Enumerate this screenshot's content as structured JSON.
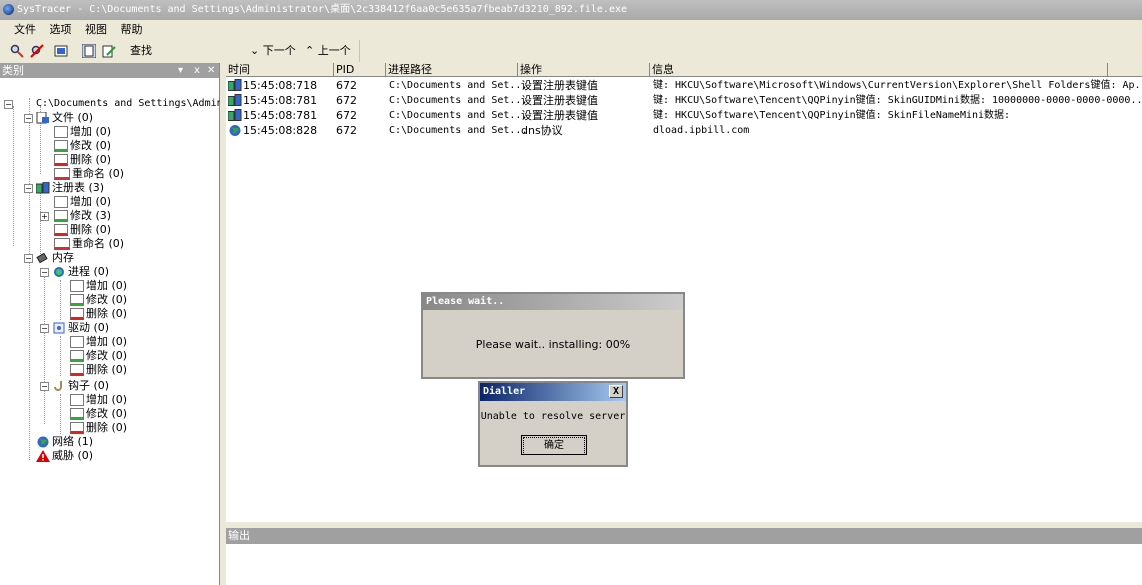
{
  "window": {
    "title": "SysTracer - C:\\Documents and Settings\\Administrator\\桌面\\2c338412f6aa0c5e635a7fbeab7d3210_892.file.exe"
  },
  "menu": [
    "文件",
    "选项",
    "视图",
    "帮助"
  ],
  "toolbar": {
    "search_label": "查找",
    "search_value": "",
    "next_label": "下一个",
    "prev_label": "上一个"
  },
  "left": {
    "title": "类别",
    "controls": [
      "▾",
      "ⅹ",
      "✕"
    ],
    "root": "C:\\Documents and Settings\\Administ",
    "tree": {
      "file": "文件 (0)",
      "file_add": "增加 (0)",
      "file_mod": "修改 (0)",
      "file_del": "删除 (0)",
      "file_ren": "重命名 (0)",
      "reg": "注册表 (3)",
      "reg_add": "增加 (0)",
      "reg_mod": "修改 (3)",
      "reg_del": "删除 (0)",
      "reg_ren": "重命名 (0)",
      "mem": "内存",
      "proc": "进程 (0)",
      "proc_add": "增加 (0)",
      "proc_mod": "修改 (0)",
      "proc_del": "删除 (0)",
      "drv": "驱动 (0)",
      "drv_add": "增加 (0)",
      "drv_mod": "修改 (0)",
      "drv_del": "删除 (0)",
      "hook": "钩子 (0)",
      "hook_add": "增加 (0)",
      "hook_mod": "修改 (0)",
      "hook_del": "删除 (0)",
      "net": "网络 (1)",
      "threat": "威胁 (0)"
    }
  },
  "list": {
    "columns": [
      "时间",
      "PID",
      "进程路径",
      "操作",
      "信息"
    ],
    "rows": [
      {
        "time": "15:45:08:718",
        "pid": "672",
        "path": "C:\\Documents and Set...",
        "op": "设置注册表键值",
        "info": "键: HKCU\\Software\\Microsoft\\Windows\\CurrentVersion\\Explorer\\Shell Folders键值: Ap..."
      },
      {
        "time": "15:45:08:781",
        "pid": "672",
        "path": "C:\\Documents and Set...",
        "op": "设置注册表键值",
        "info": "键: HKCU\\Software\\Tencent\\QQPinyin键值: SkinGUIDMini数据: 10000000-0000-0000-0000..."
      },
      {
        "time": "15:45:08:781",
        "pid": "672",
        "path": "C:\\Documents and Set...",
        "op": "设置注册表键值",
        "info": "键: HKCU\\Software\\Tencent\\QQPinyin键值: SkinFileNameMini数据:"
      },
      {
        "time": "15:45:08:828",
        "pid": "672",
        "path": "C:\\Documents and Set...",
        "op": "dns协议",
        "info": "dload.ipbill.com"
      }
    ]
  },
  "output": {
    "title": "输出"
  },
  "wait_dialog": {
    "title": "Please wait..",
    "message": "Please wait.. installing: 00%"
  },
  "dialler": {
    "title": "Dialler",
    "message": "Unable to resolve server",
    "ok": "确定",
    "close": "X"
  }
}
